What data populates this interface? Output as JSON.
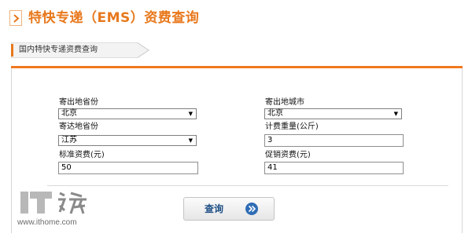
{
  "page": {
    "title": "特快专递（EMS）资费查询",
    "section_tab": "国内特快专递资费查询"
  },
  "form": {
    "origin_province": {
      "label": "寄出地省份",
      "value": "北京"
    },
    "origin_city": {
      "label": "寄出地城市",
      "value": "北京"
    },
    "dest_province": {
      "label": "寄达地省份",
      "value": "江苏"
    },
    "weight": {
      "label": "计费重量(公斤)",
      "value": "3"
    },
    "standard_fee": {
      "label": "标准资费(元)",
      "value": "50"
    },
    "promo_fee": {
      "label": "促销资费(元)",
      "value": "41"
    }
  },
  "actions": {
    "query_label": "查询"
  },
  "watermark": {
    "url": "www.ithome.com"
  },
  "colors": {
    "accent": "#e8781c",
    "panel_bar": "#f07a1e",
    "button_text": "#1f4f86",
    "go_icon": "#2f6db5"
  },
  "icons": {
    "title_marker": "chevron-right-icon",
    "query_go": "double-chevron-right-icon",
    "select_arrow": "dropdown-arrow-icon"
  }
}
